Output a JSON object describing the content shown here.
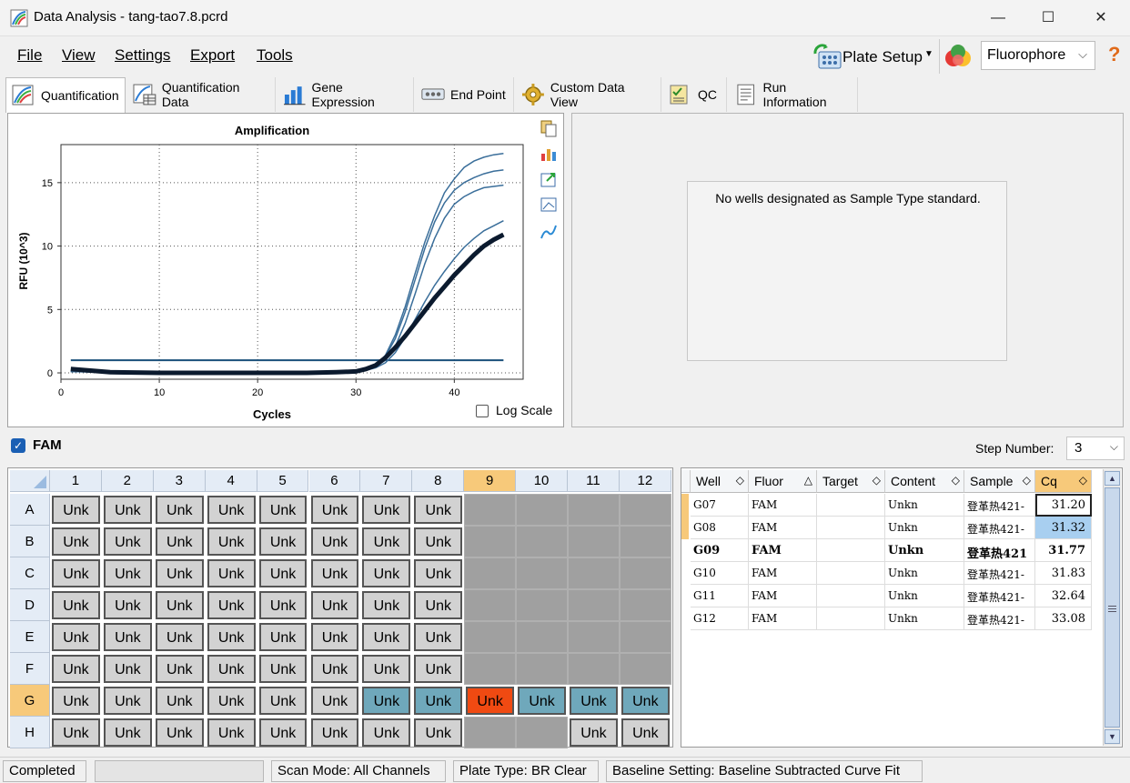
{
  "window": {
    "title": "Data Analysis - tang-tao7.8.pcrd",
    "minimize": "—",
    "maximize": "☐",
    "close": "✕"
  },
  "menu": {
    "file": "File",
    "view": "View",
    "settings": "Settings",
    "export": "Export",
    "tools": "Tools",
    "plate_setup": "Plate Setup",
    "fluorophore": "Fluorophore",
    "help": "?"
  },
  "tabs": [
    "Quantification",
    "Quantification Data",
    "Gene Expression",
    "End Point",
    "Custom Data View",
    "QC",
    "Run Information"
  ],
  "chart": {
    "title": "Amplification",
    "xlabel": "Cycles",
    "ylabel": "RFU (10^3)",
    "log_scale_label": "Log Scale"
  },
  "chart_data": {
    "type": "line",
    "title": "Amplification",
    "xlabel": "Cycles",
    "ylabel": "RFU (10^3)",
    "xlim": [
      0,
      47
    ],
    "ylim": [
      -0.5,
      18
    ],
    "xticks": [
      0,
      10,
      20,
      30,
      40
    ],
    "yticks": [
      0,
      5,
      10,
      15
    ],
    "grid": true,
    "threshold": 1.0,
    "series": [
      {
        "x": [
          1,
          5,
          10,
          15,
          20,
          25,
          28,
          30,
          31,
          32,
          33,
          34,
          35,
          36,
          37,
          38,
          39,
          40,
          41,
          42,
          43,
          44,
          45
        ],
        "y": [
          0.1,
          0.05,
          0,
          0,
          0,
          0,
          0.05,
          0.15,
          0.3,
          0.6,
          1.4,
          3.0,
          5.2,
          7.8,
          10.3,
          12.4,
          14.2,
          15.3,
          16.2,
          16.7,
          17.0,
          17.2,
          17.3
        ]
      },
      {
        "x": [
          1,
          5,
          10,
          15,
          20,
          25,
          28,
          30,
          31,
          32,
          33,
          34,
          35,
          36,
          37,
          38,
          39,
          40,
          41,
          42,
          43,
          44,
          45
        ],
        "y": [
          0.1,
          0.05,
          0,
          0,
          0,
          0,
          0.05,
          0.15,
          0.3,
          0.6,
          1.3,
          2.7,
          4.8,
          7.3,
          9.8,
          11.9,
          13.4,
          14.4,
          15.0,
          15.4,
          15.7,
          15.9,
          16.0
        ]
      },
      {
        "x": [
          1,
          5,
          10,
          15,
          20,
          25,
          28,
          30,
          31,
          32,
          33,
          34,
          35,
          36,
          37,
          38,
          39,
          40,
          41,
          42,
          43,
          44,
          45
        ],
        "y": [
          0.1,
          0.05,
          0,
          0,
          0,
          0,
          0.05,
          0.12,
          0.25,
          0.5,
          1.0,
          2.1,
          3.9,
          6.2,
          8.6,
          10.6,
          12.2,
          13.3,
          13.9,
          14.3,
          14.6,
          14.7,
          14.8
        ]
      },
      {
        "x": [
          1,
          5,
          10,
          15,
          20,
          25,
          28,
          30,
          31,
          32,
          33,
          34,
          35,
          36,
          37,
          38,
          39,
          40,
          41,
          42,
          43,
          44,
          45
        ],
        "y": [
          0.2,
          0.05,
          0,
          0,
          0,
          0,
          0.05,
          0.1,
          0.2,
          0.4,
          0.8,
          1.6,
          2.8,
          4.2,
          5.6,
          6.9,
          8.0,
          9.0,
          9.9,
          10.6,
          11.2,
          11.6,
          12.0
        ]
      },
      {
        "x": [
          1,
          5,
          10,
          15,
          20,
          25,
          28,
          30,
          31,
          32,
          33,
          34,
          35,
          36,
          37,
          38,
          39,
          40,
          41,
          42,
          43,
          44,
          45
        ],
        "y": [
          0.3,
          0.05,
          0,
          0,
          0,
          0,
          0.05,
          0.12,
          0.3,
          0.6,
          1.2,
          2.0,
          2.9,
          3.9,
          4.9,
          5.9,
          6.8,
          7.7,
          8.5,
          9.3,
          10.0,
          10.5,
          10.9
        ]
      }
    ]
  },
  "standard_panel": {
    "message": "No wells designated as Sample Type standard."
  },
  "fam": {
    "label": "FAM",
    "step_label": "Step Number:",
    "step_value": "3"
  },
  "plate": {
    "cols": [
      "1",
      "2",
      "3",
      "4",
      "5",
      "6",
      "7",
      "8",
      "9",
      "10",
      "11",
      "12"
    ],
    "rows": [
      "A",
      "B",
      "C",
      "D",
      "E",
      "F",
      "G",
      "H"
    ],
    "unk_label": "Unk"
  },
  "table": {
    "headers": [
      "Well",
      "Fluor",
      "Target",
      "Content",
      "Sample",
      "Cq"
    ],
    "rows": [
      {
        "well": "G07",
        "fluor": "FAM",
        "target": "",
        "content": "Unkn",
        "sample": "登革热421-",
        "cq": "31.20"
      },
      {
        "well": "G08",
        "fluor": "FAM",
        "target": "",
        "content": "Unkn",
        "sample": "登革热421-",
        "cq": "31.32"
      },
      {
        "well": "G09",
        "fluor": "FAM",
        "target": "",
        "content": "Unkn",
        "sample": "登革热421",
        "cq": "31.77"
      },
      {
        "well": "G10",
        "fluor": "FAM",
        "target": "",
        "content": "Unkn",
        "sample": "登革热421-",
        "cq": "31.83"
      },
      {
        "well": "G11",
        "fluor": "FAM",
        "target": "",
        "content": "Unkn",
        "sample": "登革热421-",
        "cq": "32.64"
      },
      {
        "well": "G12",
        "fluor": "FAM",
        "target": "",
        "content": "Unkn",
        "sample": "登革热421-",
        "cq": "33.08"
      }
    ]
  },
  "status": {
    "completed": "Completed",
    "scan_mode": "Scan Mode: All Channels",
    "plate_type": "Plate Type: BR Clear",
    "baseline": "Baseline Setting: Baseline Subtracted Curve Fit"
  }
}
